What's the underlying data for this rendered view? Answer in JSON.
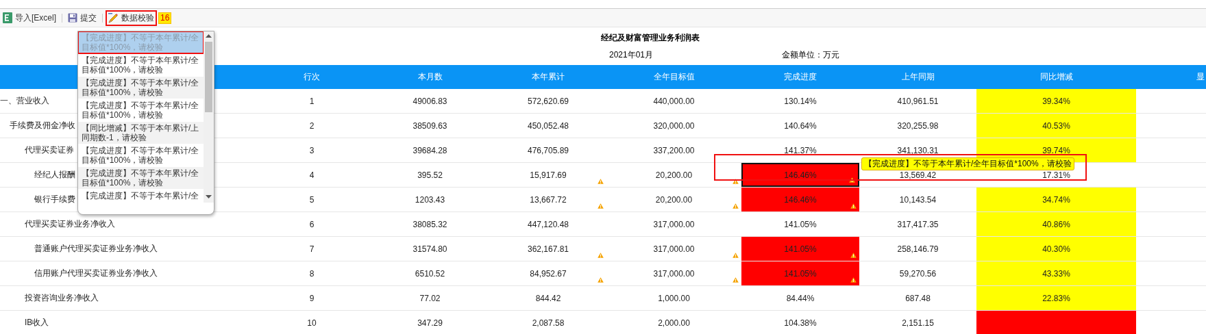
{
  "toolbar": {
    "buttons": [
      {
        "kind": "excel",
        "label": "导入[Excel]",
        "highlighted": false
      },
      {
        "kind": "save",
        "label": "提交",
        "highlighted": false
      },
      {
        "kind": "check",
        "label": "数据校验",
        "highlighted": true,
        "badge": "16"
      }
    ]
  },
  "report": {
    "title": "经纪及财富管理业务利润表",
    "period": "2021年01月",
    "unit": "金额单位：万元"
  },
  "table": {
    "columns": [
      "行次",
      "本月数",
      "本年累计",
      "全年目标值",
      "完成进度",
      "上年同期",
      "同比增减",
      "显"
    ],
    "rows": [
      {
        "name": "一、营业收入",
        "line_no": "1",
        "month": "49006.83",
        "ytd": "572,620.69",
        "target": "440,000.00",
        "progress": "130.14%",
        "last_year": "410,961.51",
        "yoy": "39.34%",
        "ytd_warn": false,
        "target_warn": false,
        "progress_warn": false,
        "progress_error": false,
        "selected": false,
        "yoy_warning": true,
        "yoy_error": false,
        "children": [
          {
            "name": "手续费及佣金净收",
            "line_no": "2",
            "month": "38509.63",
            "ytd": "450,052.48",
            "target": "320,000.00",
            "progress": "140.64%",
            "last_year": "320,255.98",
            "yoy": "40.53%",
            "ytd_warn": false,
            "target_warn": false,
            "progress_warn": false,
            "progress_error": false,
            "selected": false,
            "yoy_warning": true,
            "yoy_error": false,
            "children": [
              {
                "name": "代理买卖证券",
                "line_no": "3",
                "month": "39684.28",
                "ytd": "476,705.89",
                "target": "337,200.00",
                "progress": "141.37%",
                "last_year": "341,130.31",
                "yoy": "39.74%",
                "ytd_warn": false,
                "target_warn": false,
                "progress_warn": false,
                "progress_error": false,
                "selected": false,
                "yoy_warning": true,
                "yoy_error": false,
                "children": [
                  {
                    "name": "经纪人报酬",
                    "line_no": "4",
                    "month": "395.52",
                    "ytd": "15,917.69",
                    "target": "20,200.00",
                    "progress": "146.46%",
                    "last_year": "13,569.42",
                    "yoy": "17.31%",
                    "ytd_warn": true,
                    "target_warn": true,
                    "progress_warn": true,
                    "progress_error": true,
                    "selected": true,
                    "yoy_warning": false,
                    "yoy_error": false
                  },
                  {
                    "name": "银行手续费",
                    "line_no": "5",
                    "month": "1203.43",
                    "ytd": "13,667.72",
                    "target": "20,200.00",
                    "progress": "146.46%",
                    "last_year": "10,143.54",
                    "yoy": "34.74%",
                    "ytd_warn": true,
                    "target_warn": true,
                    "progress_warn": true,
                    "progress_error": true,
                    "selected": false,
                    "yoy_warning": true,
                    "yoy_error": false
                  }
                ]
              },
              {
                "name": "代理买卖证券业务净收入",
                "line_no": "6",
                "month": "38085.32",
                "ytd": "447,120.48",
                "target": "317,000.00",
                "progress": "141.05%",
                "last_year": "317,417.35",
                "yoy": "40.86%",
                "ytd_warn": false,
                "target_warn": false,
                "progress_warn": false,
                "progress_error": false,
                "selected": false,
                "yoy_warning": true,
                "yoy_error": false,
                "children": [
                  {
                    "name": "普通账户代理买卖证券业务净收入",
                    "line_no": "7",
                    "month": "31574.80",
                    "ytd": "362,167.81",
                    "target": "317,000.00",
                    "progress": "141.05%",
                    "last_year": "258,146.79",
                    "yoy": "40.30%",
                    "ytd_warn": true,
                    "target_warn": true,
                    "progress_warn": true,
                    "progress_error": true,
                    "selected": false,
                    "yoy_warning": true,
                    "yoy_error": false
                  },
                  {
                    "name": "信用账户代理买卖证券业务净收入",
                    "line_no": "8",
                    "month": "6510.52",
                    "ytd": "84,952.67",
                    "target": "317,000.00",
                    "progress": "141.05%",
                    "last_year": "59,270.56",
                    "yoy": "43.33%",
                    "ytd_warn": true,
                    "target_warn": true,
                    "progress_warn": true,
                    "progress_error": true,
                    "selected": false,
                    "yoy_warning": true,
                    "yoy_error": false
                  }
                ]
              },
              {
                "name": "投资咨询业务净收入",
                "line_no": "9",
                "month": "77.02",
                "ytd": "844.42",
                "target": "1,000.00",
                "progress": "84.44%",
                "last_year": "687.48",
                "yoy": "22.83%",
                "ytd_warn": false,
                "target_warn": false,
                "progress_warn": false,
                "progress_error": false,
                "selected": false,
                "yoy_warning": true,
                "yoy_error": false
              },
              {
                "name": "IB收入",
                "line_no": "10",
                "month": "347.29",
                "ytd": "2,087.58",
                "target": "2,000.00",
                "progress": "104.38%",
                "last_year": "2,151.15",
                "ytd_warn": false,
                "target_warn": false,
                "progress_warn": false,
                "progress_error": false,
                "selected": false,
                "yoy_error": true
              }
            ]
          }
        ]
      }
    ]
  },
  "check_list": {
    "items": [
      {
        "line_1": "【完成进度】不等于本年累计/全",
        "line_2": "目标值*100%，请校验",
        "selected": true,
        "highlighted": true
      },
      {
        "line_1": "【完成进度】不等于本年累计/全",
        "line_2": "目标值*100%，请校验",
        "selected": false,
        "highlighted": false
      },
      {
        "line_1": "【完成进度】不等于本年累计/全",
        "line_2": "目标值*100%，请校验",
        "selected": false,
        "highlighted": false
      },
      {
        "line_1": "【完成进度】不等于本年累计/全",
        "line_2": "目标值*100%，请校验",
        "selected": false,
        "highlighted": false
      },
      {
        "line_1": "【同比增减】不等于本年累计/上",
        "line_2": "同期数-1，请校验",
        "selected": false,
        "highlighted": false
      },
      {
        "line_1": "【完成进度】不等于本年累计/全",
        "line_2": "目标值*100%，请校验",
        "selected": false,
        "highlighted": false
      },
      {
        "line_1": "【完成进度】不等于本年累计/全",
        "line_2": "目标值*100%，请校验",
        "selected": false,
        "highlighted": false
      },
      {
        "line_1": "【完成进度】不等于本年累计/全",
        "selected": false,
        "highlighted": false
      }
    ]
  },
  "tooltip": {
    "text": "【完成进度】不等于本年累计/全年目标值*100%，请校验",
    "highlighted": true
  }
}
